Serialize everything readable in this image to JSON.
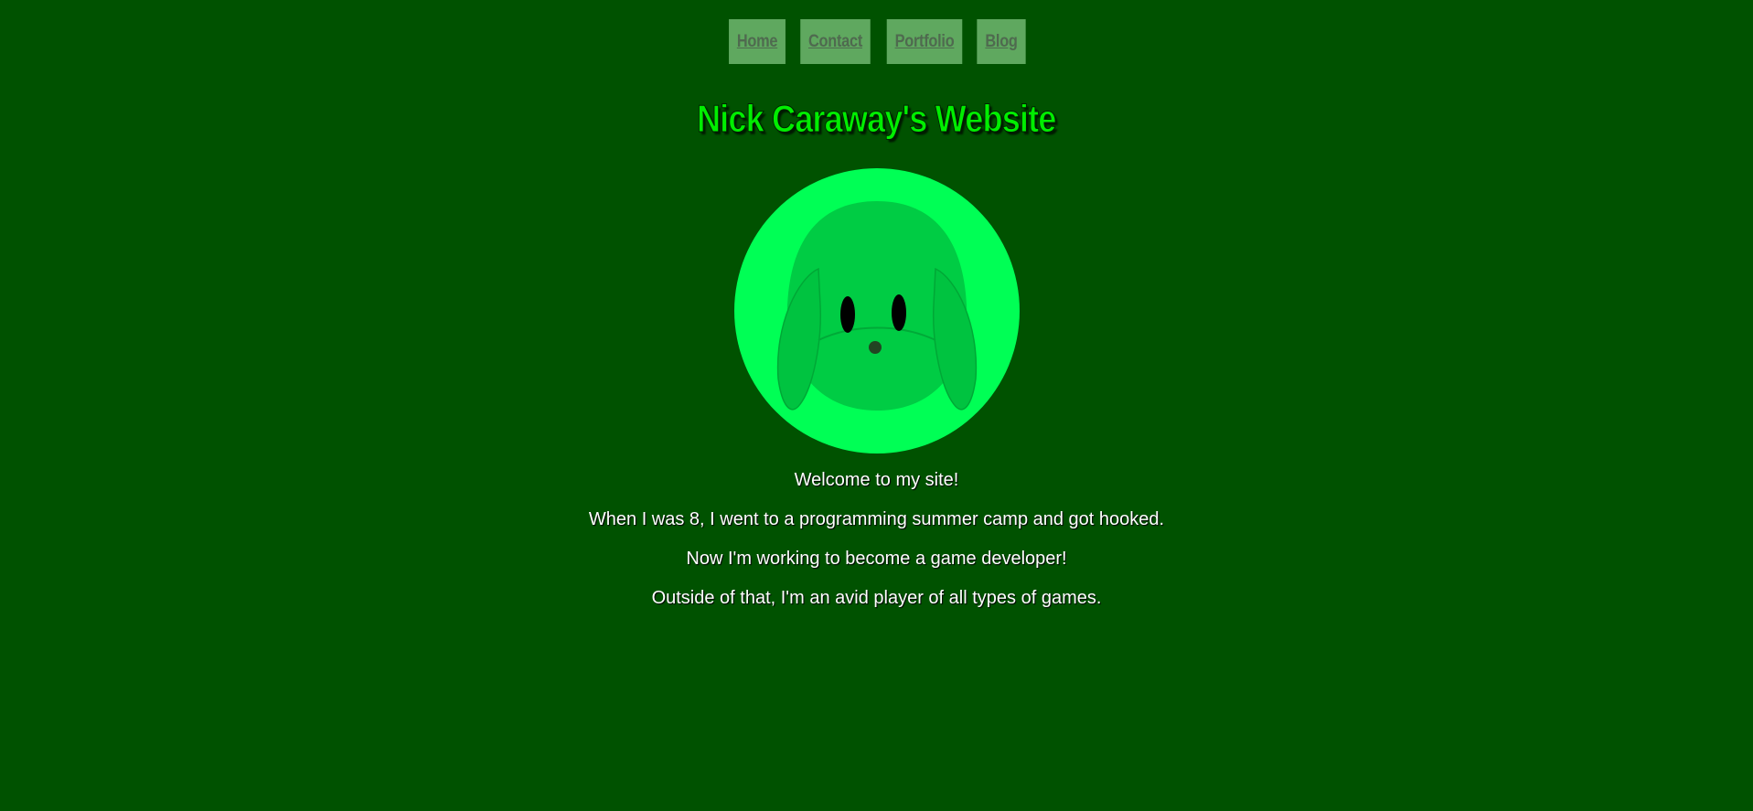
{
  "nav": {
    "items": [
      {
        "label": "Home"
      },
      {
        "label": "Contact"
      },
      {
        "label": "Portfolio"
      },
      {
        "label": "Blog"
      }
    ]
  },
  "header": {
    "title": "Nick Caraway's Website"
  },
  "avatar": {
    "icon": "dog-face-icon",
    "colors": {
      "ring": "#00ff55",
      "face": "#00cc44",
      "eyes": "#000000",
      "nose": "#224422"
    }
  },
  "content": {
    "paragraphs": [
      "Welcome to my site!",
      "When I was 8, I went to a programming summer camp and got hooked.",
      "Now I'm working to become a game developer!",
      "Outside of that, I'm an avid player of all types of games."
    ]
  },
  "colors": {
    "background": "#005200",
    "nav_bg": "#5fa85f",
    "title": "#00ee00"
  }
}
